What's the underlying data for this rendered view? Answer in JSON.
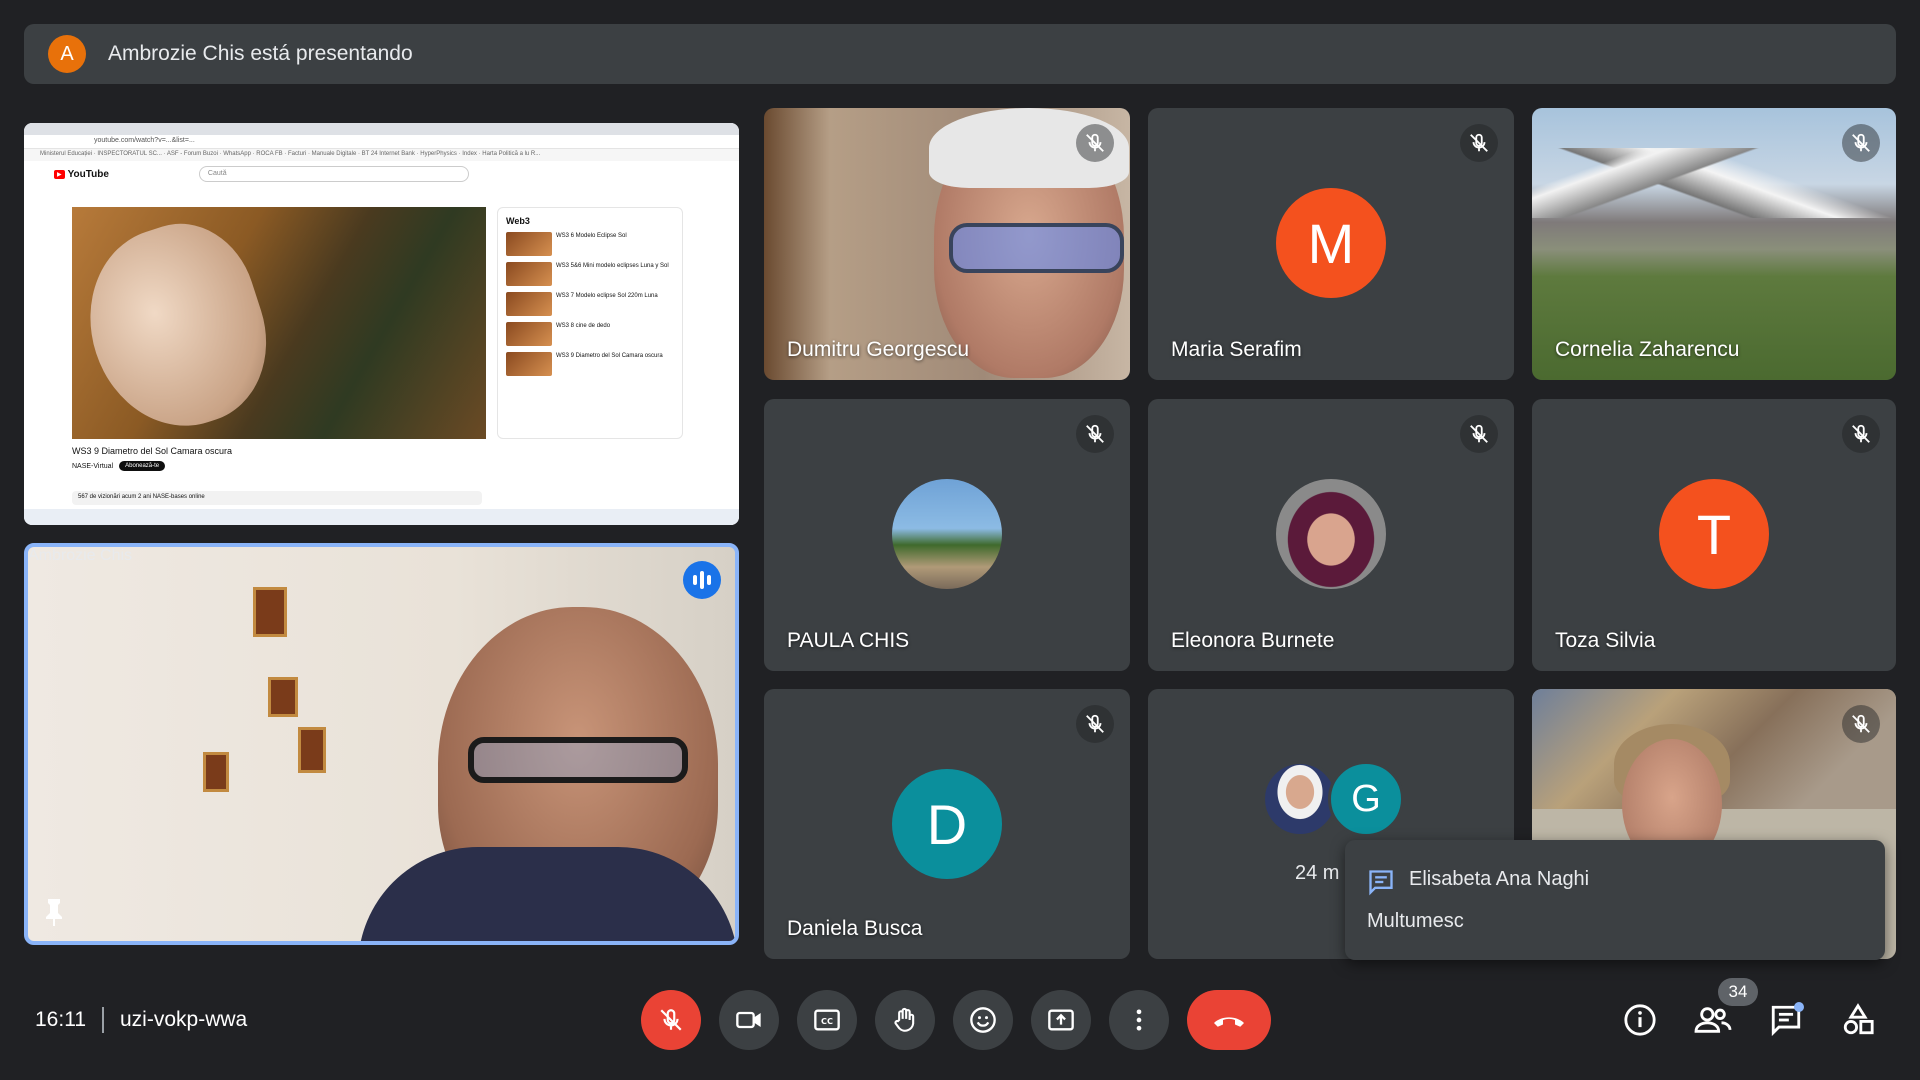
{
  "banner": {
    "avatar_letter": "A",
    "text": "Ambrozie Chis está presentando"
  },
  "presentation": {
    "url": "youtube.com/watch?v=...&list=...",
    "bookmarks": "Ministerul Educației · INSPECTORATUL SC... · ASF - Forum Buzoi · WhatsApp · ROCA FB · Facturi · Manuale Digitale · BT 24 Internet Bank · HyperPhysics · Index · Harta Politică a lu R...",
    "yt_logo": "YouTube",
    "yt_search": "Caută",
    "playlist_title": "Web3",
    "playlist_items": [
      "WS3 6 Modelo Eclipse Sol",
      "WS3 5&6 Mini modelo eclipses Luna y Sol",
      "WS3 7 Modelo eclipse Sol 220m Luna",
      "WS3 8 cine de dedo",
      "WS3 9 Diametro del Sol Camara oscura"
    ],
    "video_title": "WS3 9 Diametro del Sol Camara oscura",
    "channel": "NASE-Virtual",
    "subscribe": "Abonează-te",
    "description": "567 de vizionări  acum 2 ani  NASE-bases online"
  },
  "self_tile": {
    "name": "Ambrozie Chis"
  },
  "participants": [
    {
      "name": "Dumitru Georgescu"
    },
    {
      "name": "Maria Serafim",
      "letter": "M",
      "color": "#f4511e"
    },
    {
      "name": "Cornelia Zaharencu"
    },
    {
      "name": "PAULA CHIS"
    },
    {
      "name": "Eleonora Burnete"
    },
    {
      "name": "Toza Silvia",
      "letter": "T",
      "color": "#f4511e"
    },
    {
      "name": "Daniela Busca",
      "letter": "D",
      "color": "#0b8f9c"
    },
    {
      "name": "24 m",
      "letter": "G",
      "color": "#0b8f9c"
    }
  ],
  "chat_popup": {
    "sender": "Elisabeta Ana Naghi",
    "message": "Multumesc"
  },
  "bottom": {
    "time": "16:11",
    "meeting_code": "uzi-vokp-wwa",
    "people_count": "34"
  },
  "colors": {
    "bg": "#202124",
    "tile": "#3c4043",
    "red": "#ea4335",
    "accent": "#8ab4f8"
  }
}
